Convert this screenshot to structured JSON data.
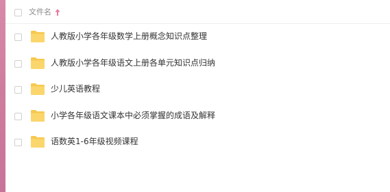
{
  "header": {
    "filename_label": "文件名"
  },
  "rows": [
    {
      "name": "人教版小学各年级数学上册概念知识点整理"
    },
    {
      "name": "人教版小学各年级语文上册各单元知识点归纳"
    },
    {
      "name": "少儿英语教程"
    },
    {
      "name": "小学各年级语文课本中必须掌握的成语及解释"
    },
    {
      "name": "语数英1-6年级视频课程"
    }
  ],
  "colors": {
    "folder": "#f6c94f",
    "sort_arrow": "#e87aa0",
    "left_strip": "#cf7d9e"
  },
  "icons": {
    "folder": "folder-icon",
    "sort": "sort-arrow-icon"
  }
}
